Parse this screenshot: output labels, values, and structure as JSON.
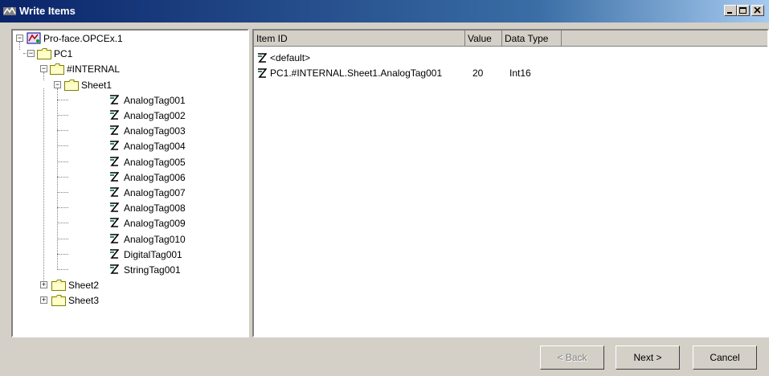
{
  "window": {
    "title": "Write Items",
    "icon": "opc-window-icon",
    "controls": [
      "minimize-icon",
      "maximize-icon",
      "close-icon"
    ]
  },
  "tree": {
    "server": "Pro-face.OPCEx.1",
    "device": "PC1",
    "group": "#INTERNAL",
    "sheet1": "Sheet1",
    "tags": [
      "AnalogTag001",
      "AnalogTag002",
      "AnalogTag003",
      "AnalogTag004",
      "AnalogTag005",
      "AnalogTag006",
      "AnalogTag007",
      "AnalogTag008",
      "AnalogTag009",
      "AnalogTag010",
      "DigitalTag001",
      "StringTag001"
    ],
    "sheet2": "Sheet2",
    "sheet3": "Sheet3"
  },
  "items": {
    "columns": [
      "Item ID",
      "Value",
      "Data Type"
    ],
    "rows": [
      {
        "item_id": "<default>",
        "value": "",
        "data_type": ""
      },
      {
        "item_id": "PC1.#INTERNAL.Sheet1.AnalogTag001",
        "value": "20",
        "data_type": "Int16"
      }
    ]
  },
  "buttons": {
    "back": "< Back",
    "next": "Next >",
    "cancel": "Cancel"
  }
}
